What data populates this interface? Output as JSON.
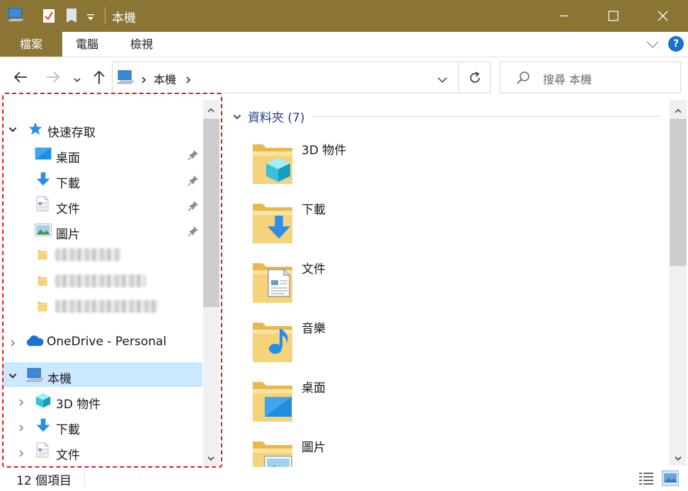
{
  "window": {
    "title": "本機",
    "accent": "#8a7534"
  },
  "ribbon": {
    "tabs": [
      {
        "label": "檔案",
        "active": true
      },
      {
        "label": "電腦"
      },
      {
        "label": "檢視"
      }
    ],
    "help_label": "?"
  },
  "address": {
    "crumb": "本機",
    "search_placeholder": "搜尋 本機"
  },
  "nav": {
    "quick_access": "快速存取",
    "pinned": [
      {
        "label": "桌面",
        "icon": "desktop-icon"
      },
      {
        "label": "下載",
        "icon": "download-icon"
      },
      {
        "label": "文件",
        "icon": "document-icon"
      },
      {
        "label": "圖片",
        "icon": "pictures-icon"
      }
    ],
    "onedrive": "OneDrive - Personal",
    "this_pc": "本機",
    "pc_children": [
      {
        "label": "3D 物件",
        "icon": "3d-objects-icon"
      },
      {
        "label": "下載",
        "icon": "download-icon"
      },
      {
        "label": "文件",
        "icon": "document-icon"
      }
    ]
  },
  "content": {
    "group_header": "資料夾 (7)",
    "folders": [
      {
        "label": "3D 物件",
        "icon": "3d-objects-folder-icon"
      },
      {
        "label": "下載",
        "icon": "download-folder-icon"
      },
      {
        "label": "文件",
        "icon": "document-folder-icon"
      },
      {
        "label": "音樂",
        "icon": "music-folder-icon"
      },
      {
        "label": "桌面",
        "icon": "desktop-folder-icon"
      },
      {
        "label": "圖片",
        "icon": "pictures-folder-icon"
      }
    ]
  },
  "status": {
    "item_count": "12 個項目"
  }
}
